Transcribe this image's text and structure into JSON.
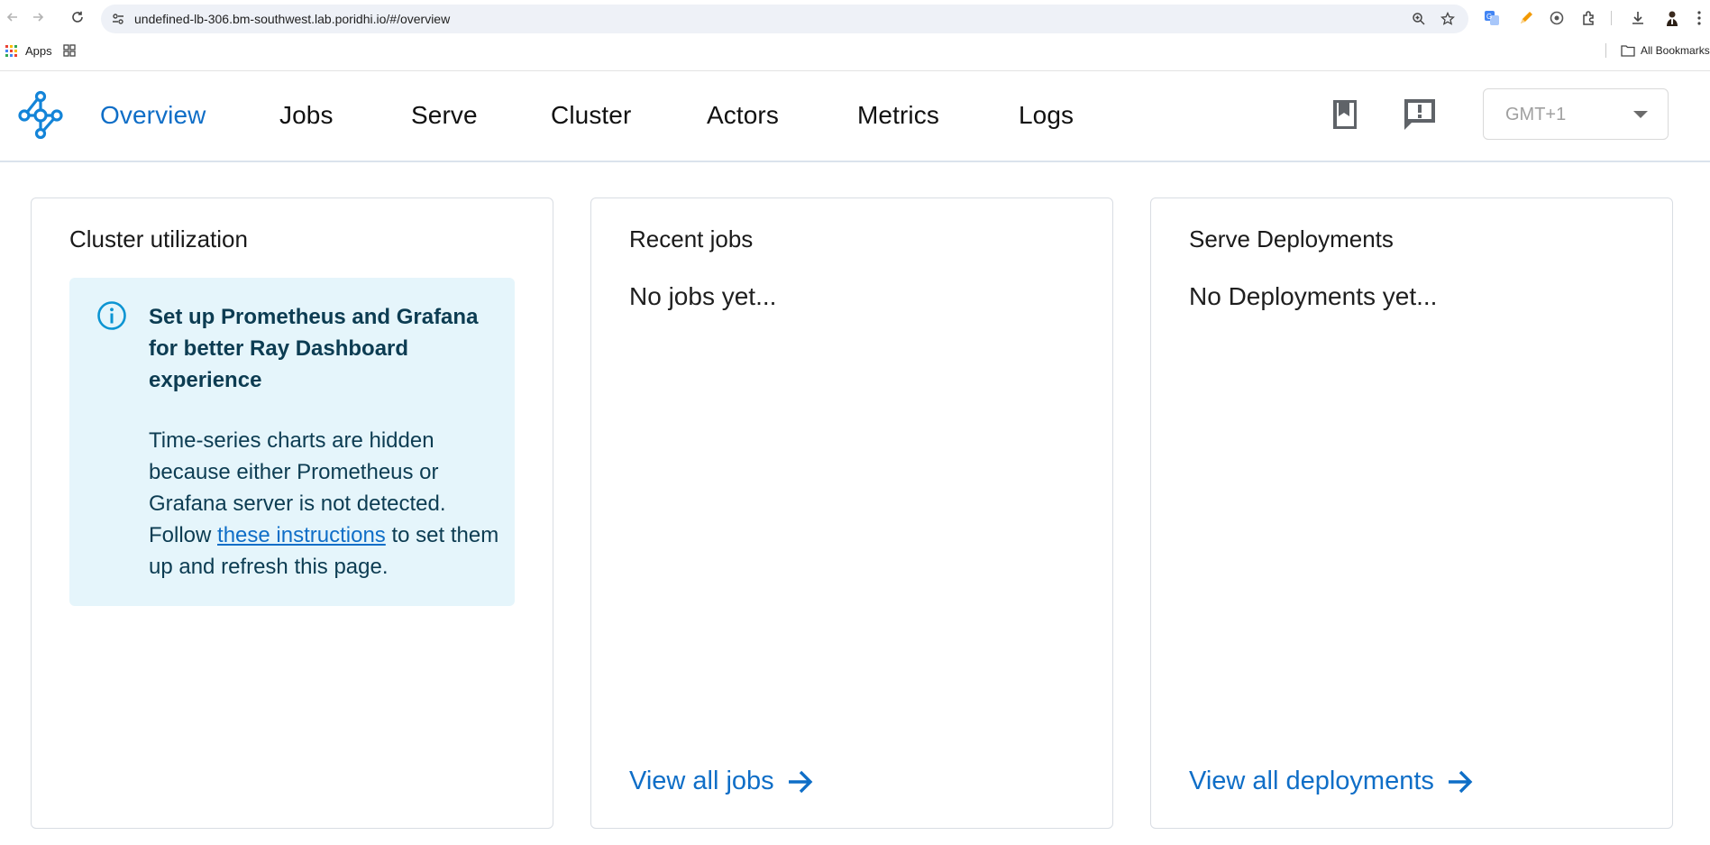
{
  "browser": {
    "url": "undefined-lb-306.bm-southwest.lab.poridhi.io/#/overview",
    "bookmarks": {
      "apps_label": "Apps",
      "all_bookmarks_label": "All Bookmarks"
    }
  },
  "header": {
    "nav": [
      {
        "label": "Overview",
        "active": true
      },
      {
        "label": "Jobs"
      },
      {
        "label": "Serve"
      },
      {
        "label": "Cluster"
      },
      {
        "label": "Actors"
      },
      {
        "label": "Metrics"
      },
      {
        "label": "Logs"
      }
    ],
    "timezone": "GMT+1"
  },
  "cards": {
    "cluster": {
      "title": "Cluster utilization",
      "alert": {
        "heading": "Set up Prometheus and Grafana for better Ray Dashboard experience",
        "body_before": "Time-series charts are hidden because either Prometheus or Grafana server is not detected. Follow ",
        "link": "these instructions",
        "body_after": " to set them up and refresh this page."
      }
    },
    "jobs": {
      "title": "Recent jobs",
      "empty": "No jobs yet...",
      "link": "View all jobs"
    },
    "deployments": {
      "title": "Serve Deployments",
      "empty": "No Deployments yet...",
      "link": "View all deployments"
    }
  },
  "colors": {
    "accent": "#0f6ec7",
    "alert_bg": "#e5f5fb",
    "alert_text": "#0c3c52"
  }
}
